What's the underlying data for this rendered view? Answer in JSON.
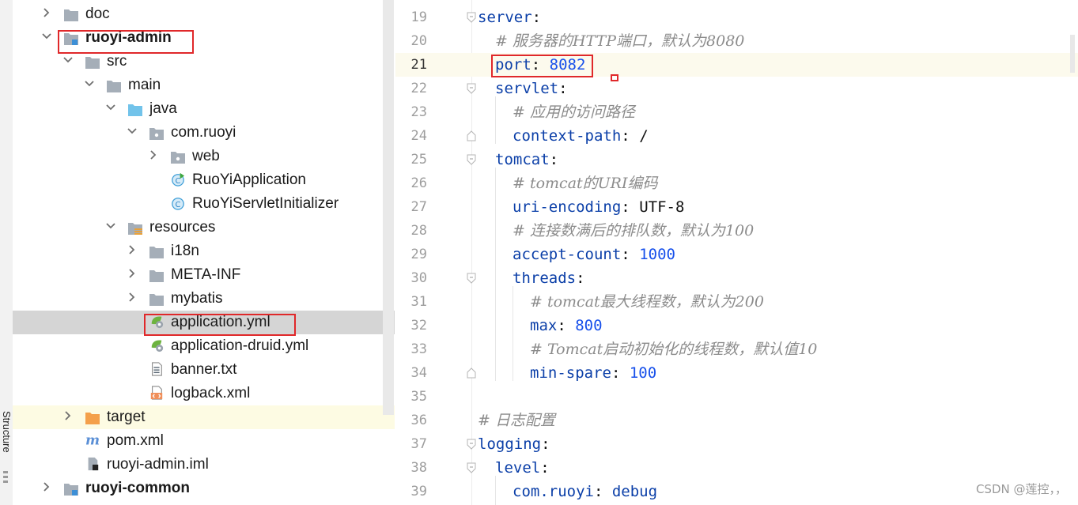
{
  "structure_tab": {
    "label": "Structure"
  },
  "tree": {
    "items": [
      {
        "label": "doc"
      },
      {
        "label": "ruoyi-admin"
      },
      {
        "label": "src"
      },
      {
        "label": "main"
      },
      {
        "label": "java"
      },
      {
        "label": "com.ruoyi"
      },
      {
        "label": "web"
      },
      {
        "label": "RuoYiApplication"
      },
      {
        "label": "RuoYiServletInitializer"
      },
      {
        "label": "resources"
      },
      {
        "label": "i18n"
      },
      {
        "label": "META-INF"
      },
      {
        "label": "mybatis"
      },
      {
        "label": "application.yml"
      },
      {
        "label": "application-druid.yml"
      },
      {
        "label": "banner.txt"
      },
      {
        "label": "logback.xml"
      },
      {
        "label": "target"
      },
      {
        "label": "pom.xml"
      },
      {
        "label": "ruoyi-admin.iml"
      },
      {
        "label": "ruoyi-common"
      }
    ]
  },
  "editor": {
    "lines": [
      {
        "num": "19",
        "key": "server",
        "colon": ":",
        "value": "",
        "comment": ""
      },
      {
        "num": "20",
        "key": "",
        "colon": "",
        "value": "",
        "comment": "# 服务器的HTTP端口，默认为8080"
      },
      {
        "num": "21",
        "key": "port",
        "colon": ":",
        "value": "8082",
        "comment": ""
      },
      {
        "num": "22",
        "key": "servlet",
        "colon": ":",
        "value": "",
        "comment": ""
      },
      {
        "num": "23",
        "key": "",
        "colon": "",
        "value": "",
        "comment": "# 应用的访问路径"
      },
      {
        "num": "24",
        "key": "context-path",
        "colon": ":",
        "value": "/",
        "comment": ""
      },
      {
        "num": "25",
        "key": "tomcat",
        "colon": ":",
        "value": "",
        "comment": ""
      },
      {
        "num": "26",
        "key": "",
        "colon": "",
        "value": "",
        "comment": "# tomcat的URI编码"
      },
      {
        "num": "27",
        "key": "uri-encoding",
        "colon": ":",
        "value": "UTF-8",
        "comment": ""
      },
      {
        "num": "28",
        "key": "",
        "colon": "",
        "value": "",
        "comment": "# 连接数满后的排队数，默认为100"
      },
      {
        "num": "29",
        "key": "accept-count",
        "colon": ":",
        "value": "1000",
        "comment": ""
      },
      {
        "num": "30",
        "key": "threads",
        "colon": ":",
        "value": "",
        "comment": ""
      },
      {
        "num": "31",
        "key": "",
        "colon": "",
        "value": "",
        "comment": "# tomcat最大线程数，默认为200"
      },
      {
        "num": "32",
        "key": "max",
        "colon": ":",
        "value": "800",
        "comment": ""
      },
      {
        "num": "33",
        "key": "",
        "colon": "",
        "value": "",
        "comment": "# Tomcat启动初始化的线程数，默认值10"
      },
      {
        "num": "34",
        "key": "min-spare",
        "colon": ":",
        "value": "100",
        "comment": ""
      },
      {
        "num": "35",
        "key": "",
        "colon": "",
        "value": "",
        "comment": ""
      },
      {
        "num": "36",
        "key": "",
        "colon": "",
        "value": "",
        "comment": "# 日志配置"
      },
      {
        "num": "37",
        "key": "logging",
        "colon": ":",
        "value": "",
        "comment": ""
      },
      {
        "num": "38",
        "key": "level",
        "colon": ":",
        "value": "",
        "comment": ""
      },
      {
        "num": "39",
        "key": "com.ruoyi",
        "colon": ":",
        "value": "debug",
        "comment": ""
      }
    ]
  },
  "watermark": {
    "text": "CSDN @莲控，，"
  },
  "colors": {
    "yaml_key": "#0b3fa8",
    "yaml_number": "#1750eb",
    "comment": "#8c8c8c",
    "highlight_box": "#e0282a",
    "selected_row": "#d5d5d5",
    "current_line": "#fcfaed"
  }
}
